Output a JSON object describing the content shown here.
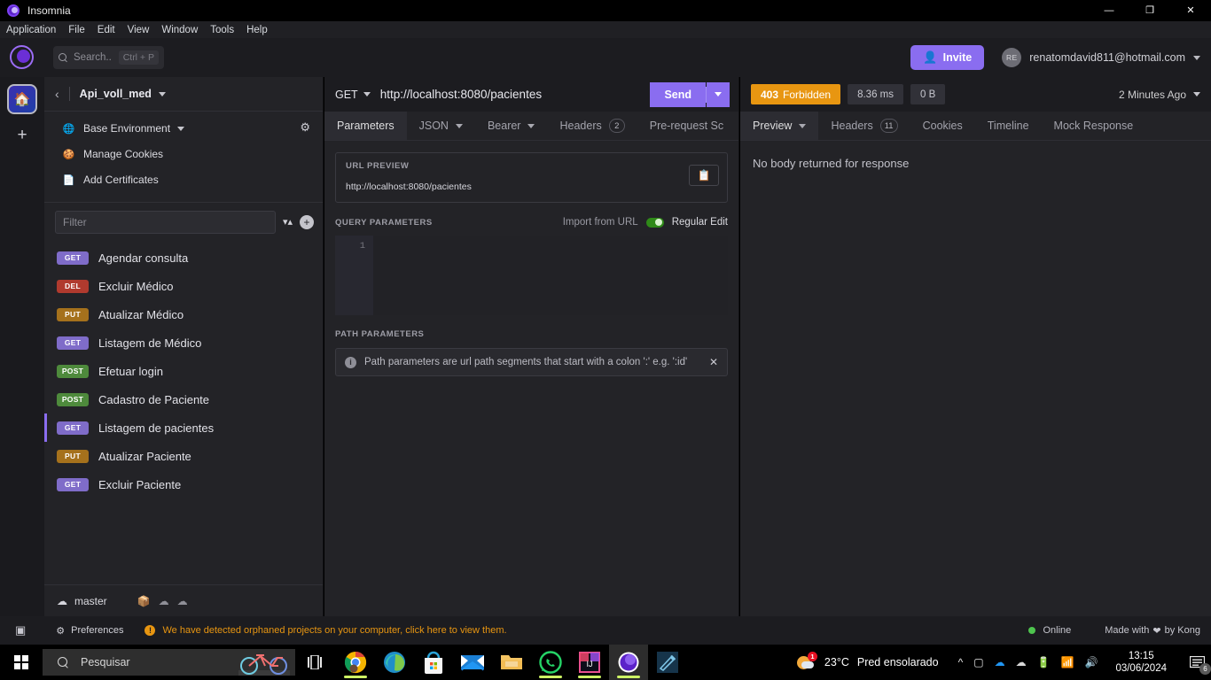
{
  "os_window": {
    "title": "Insomnia",
    "controls": {
      "minimize": "—",
      "maximize": "❐",
      "close": "✕"
    }
  },
  "menubar": {
    "items": [
      "Application",
      "File",
      "Edit",
      "View",
      "Window",
      "Tools",
      "Help"
    ]
  },
  "header": {
    "search": {
      "placeholder": "Search..",
      "shortcut": "Ctrl + P"
    },
    "invite_label": "Invite",
    "avatar_initials": "RE",
    "user_email": "renatomdavid811@hotmail.com"
  },
  "sidebar": {
    "project_name": "Api_voll_med",
    "env_items": [
      {
        "label": "Base Environment",
        "icon": "globe-icon",
        "has_caret": true
      },
      {
        "label": "Manage Cookies",
        "icon": "cookie-icon",
        "has_caret": false
      },
      {
        "label": "Add Certificates",
        "icon": "certificate-icon",
        "has_caret": false
      }
    ],
    "filter_placeholder": "Filter",
    "requests": [
      {
        "method": "GET",
        "name": "Agendar consulta",
        "active": false
      },
      {
        "method": "DEL",
        "name": "Excluir Médico",
        "active": false
      },
      {
        "method": "PUT",
        "name": "Atualizar Médico",
        "active": false
      },
      {
        "method": "GET",
        "name": "Listagem de Médico",
        "active": false
      },
      {
        "method": "POST",
        "name": "Efetuar login",
        "active": false
      },
      {
        "method": "POST",
        "name": "Cadastro de Paciente",
        "active": false
      },
      {
        "method": "GET",
        "name": "Listagem de pacientes",
        "active": true
      },
      {
        "method": "PUT",
        "name": "Atualizar Paciente",
        "active": false
      },
      {
        "method": "GET",
        "name": "Excluir Paciente",
        "active": false
      }
    ],
    "branch": "master"
  },
  "request": {
    "method": "GET",
    "url": "http://localhost:8080/pacientes",
    "send_label": "Send",
    "tabs": [
      {
        "label": "Parameters",
        "active": true,
        "caret": false,
        "badge": null
      },
      {
        "label": "JSON",
        "active": false,
        "caret": true,
        "badge": null
      },
      {
        "label": "Bearer",
        "active": false,
        "caret": true,
        "badge": null
      },
      {
        "label": "Headers",
        "active": false,
        "caret": false,
        "badge": "2"
      },
      {
        "label": "Pre-request Sc",
        "active": false,
        "caret": false,
        "badge": null
      }
    ],
    "url_preview_label": "URL PREVIEW",
    "url_preview_value": "http://localhost:8080/pacientes",
    "query_params_label": "QUERY PARAMETERS",
    "import_from_url": "Import from URL",
    "regular_edit": "Regular Edit",
    "editor_line_number": "1",
    "path_params_label": "PATH PARAMETERS",
    "path_params_hint": "Path parameters are url path segments that start with a colon ':' e.g. ':id'"
  },
  "response": {
    "status_code": "403",
    "status_text": "Forbidden",
    "duration": "8.36 ms",
    "size": "0 B",
    "time_ago": "2 Minutes Ago",
    "tabs": [
      {
        "label": "Preview",
        "active": true,
        "caret": true,
        "badge": null
      },
      {
        "label": "Headers",
        "active": false,
        "caret": false,
        "badge": "11"
      },
      {
        "label": "Cookies",
        "active": false,
        "caret": false,
        "badge": null
      },
      {
        "label": "Timeline",
        "active": false,
        "caret": false,
        "badge": null
      },
      {
        "label": "Mock Response",
        "active": false,
        "caret": false,
        "badge": null
      }
    ],
    "body_message": "No body returned for response"
  },
  "footer": {
    "preferences": "Preferences",
    "warning": "We have detected orphaned projects on your computer, click here to view them.",
    "online": "Online",
    "made_with_prefix": "Made with",
    "made_with_suffix": "by Kong"
  },
  "taskbar": {
    "search_placeholder": "Pesquisar",
    "weather_temp": "23°C",
    "weather_desc": "Pred ensolarado",
    "weather_badge": "1",
    "clock_time": "13:15",
    "clock_date": "03/06/2024",
    "notification_count": "6",
    "apps": [
      {
        "name": "chrome",
        "running": true,
        "active": false
      },
      {
        "name": "edge",
        "running": false,
        "active": false
      },
      {
        "name": "store",
        "running": false,
        "active": false
      },
      {
        "name": "mail",
        "running": false,
        "active": false
      },
      {
        "name": "explorer",
        "running": false,
        "active": false
      },
      {
        "name": "whatsapp",
        "running": true,
        "active": false
      },
      {
        "name": "intellij",
        "running": true,
        "active": false
      },
      {
        "name": "insomnia",
        "running": true,
        "active": true
      },
      {
        "name": "postman",
        "running": false,
        "active": false
      }
    ]
  },
  "colors": {
    "accent_purple": "#8a6df0",
    "status_orange": "#e89611",
    "online_green": "#4ec44e",
    "get_purple": "#7f6cc9",
    "post_green": "#4e8a3c",
    "put_amber": "#a5711c",
    "del_red": "#b03a2e"
  }
}
